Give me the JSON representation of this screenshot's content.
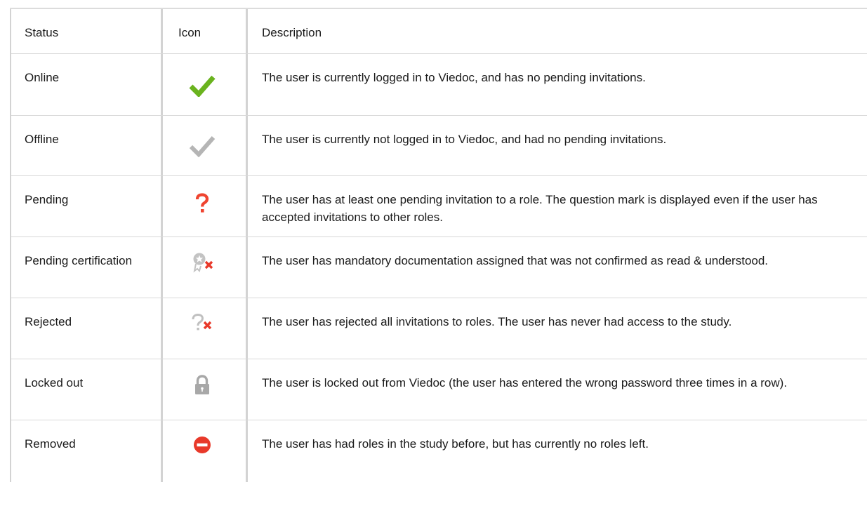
{
  "columns": {
    "status": "Status",
    "icon": "Icon",
    "description": "Description"
  },
  "rows": [
    {
      "status": "Online",
      "icon": "checkmark-green-icon",
      "description": "The user is currently logged in to Viedoc, and has no pending invitations."
    },
    {
      "status": "Offline",
      "icon": "checkmark-gray-icon",
      "description": "The user is currently not logged in to Viedoc, and had no pending invitations."
    },
    {
      "status": "Pending",
      "icon": "question-mark-red-icon",
      "description": "The user has at least one pending invitation to a role. The question mark is displayed even if the user has accepted invitations to other roles."
    },
    {
      "status": "Pending certification",
      "icon": "certificate-x-icon",
      "description": "The user has mandatory documentation assigned that was not confirmed as read & understood."
    },
    {
      "status": "Rejected",
      "icon": "question-mark-x-icon",
      "description": "The user has rejected all invitations to roles. The user has never had access to the study."
    },
    {
      "status": "Locked out",
      "icon": "padlock-icon",
      "description": "The user is locked out from Viedoc (the user has entered the wrong password three times in a row)."
    },
    {
      "status": "Removed",
      "icon": "no-entry-icon",
      "description": "The user has had roles in the study before, but has currently no roles left."
    }
  ],
  "colors": {
    "online": "#6ab31e",
    "offline": "#b5b5b5",
    "pending": "#ef4430",
    "removed": "#e8392a",
    "rule": "#d3d3d3"
  }
}
